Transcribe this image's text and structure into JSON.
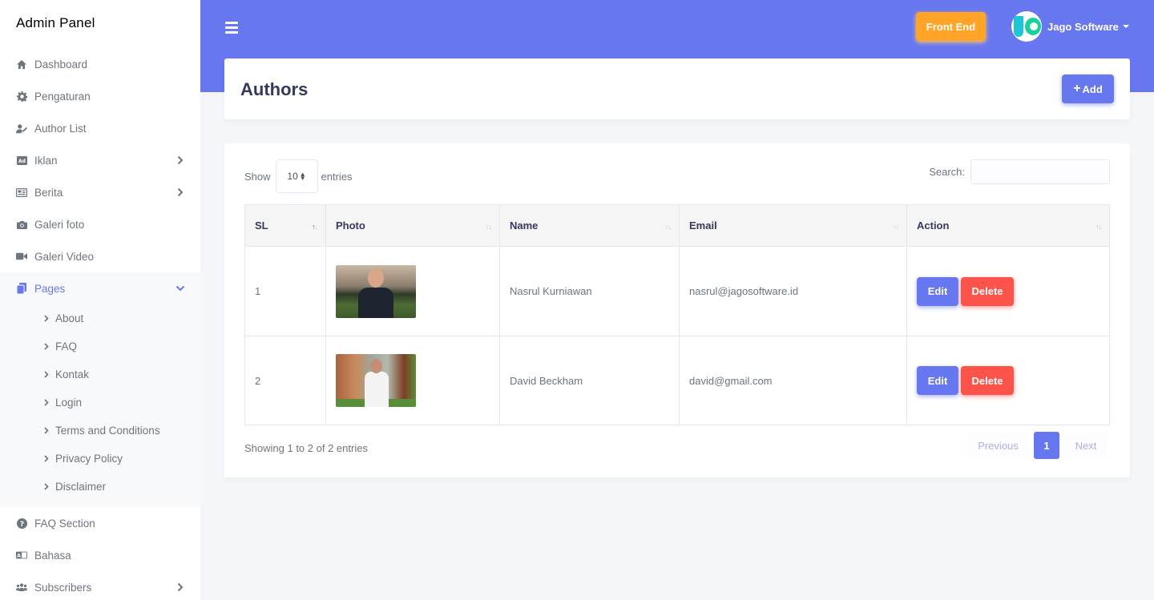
{
  "app": {
    "title": "Admin Panel"
  },
  "sidebar": {
    "items": [
      {
        "label": "Dashboard",
        "icon": "home-icon"
      },
      {
        "label": "Pengaturan",
        "icon": "gear-icon"
      },
      {
        "label": "Author List",
        "icon": "user-edit-icon"
      },
      {
        "label": "Iklan",
        "icon": "ad-icon"
      },
      {
        "label": "Berita",
        "icon": "newspaper-icon"
      },
      {
        "label": "Galeri foto",
        "icon": "camera-icon"
      },
      {
        "label": "Galeri Video",
        "icon": "video-icon"
      },
      {
        "label": "Pages",
        "icon": "copy-icon"
      }
    ],
    "pages_submenu": [
      "About",
      "FAQ",
      "Kontak",
      "Login",
      "Terms and Conditions",
      "Privacy Policy",
      "Disclaimer"
    ],
    "bottom_items": [
      {
        "label": "FAQ Section",
        "icon": "question-circle-icon"
      },
      {
        "label": "Bahasa",
        "icon": "language-icon"
      },
      {
        "label": "Subscribers",
        "icon": "users-icon"
      }
    ]
  },
  "topbar": {
    "front_end_label": "Front End",
    "user_name": "Jago Software",
    "accent": "#6777ef",
    "front_end_color": "#ffa426"
  },
  "section": {
    "title": "Authors",
    "add_label": "Add"
  },
  "table_controls": {
    "show_label": "Show",
    "entries_label": "entries",
    "page_length": "10",
    "search_label": "Search:",
    "search_value": ""
  },
  "table": {
    "columns": [
      "SL",
      "Photo",
      "Name",
      "Email",
      "Action"
    ],
    "rows": [
      {
        "sl": "1",
        "name": "Nasrul Kurniawan",
        "email": "nasrul@jagosoftware.id",
        "edit": "Edit",
        "delete": "Delete"
      },
      {
        "sl": "2",
        "name": "David Beckham",
        "email": "david@gmail.com",
        "edit": "Edit",
        "delete": "Delete"
      }
    ]
  },
  "footer": {
    "info": "Showing 1 to 2 of 2 entries",
    "previous": "Previous",
    "page": "1",
    "next": "Next"
  }
}
